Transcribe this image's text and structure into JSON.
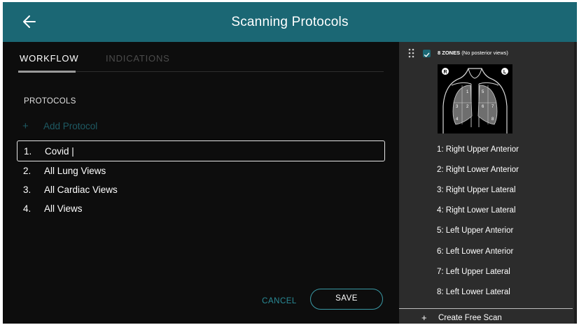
{
  "header": {
    "title": "Scanning Protocols",
    "back_icon": "arrow-left-icon",
    "color": "#1b6774"
  },
  "tabs": [
    {
      "label": "WORKFLOW",
      "active": true
    },
    {
      "label": "INDICATIONS",
      "active": false
    }
  ],
  "protocols": {
    "section_label": "PROTOCOLS",
    "add_label": "Add Protocol",
    "add_icon": "plus-icon",
    "editing": {
      "number": "1.",
      "value": "Covid |"
    },
    "items": [
      {
        "number": "2.",
        "label": "All Lung Views"
      },
      {
        "number": "3.",
        "label": "All Cardiac Views"
      },
      {
        "number": "4.",
        "label": "All Views"
      }
    ]
  },
  "actions": {
    "cancel_label": "CANCEL",
    "save_label": "SAVE",
    "accent": "#2a8b97"
  },
  "zones_panel": {
    "drag_icon": "drag-handle-icon",
    "checked": true,
    "title_strong": "8 ZONES",
    "title_note": "(No posterior views)",
    "diagram": {
      "right_marker": "R",
      "left_marker": "L",
      "zone_numbers": [
        "1",
        "2",
        "3",
        "4",
        "5",
        "6",
        "7",
        "8"
      ]
    },
    "zones": [
      "1: Right Upper Anterior",
      "2: Right Lower Anterior",
      "3: Right Upper Lateral",
      "4: Right Lower Lateral",
      "5: Left Upper Anterior",
      "6: Left Lower Anterior",
      "7: Left Upper Lateral",
      "8: Left Lower Lateral"
    ],
    "create_label": "Create Free Scan",
    "create_icon": "plus-icon"
  }
}
